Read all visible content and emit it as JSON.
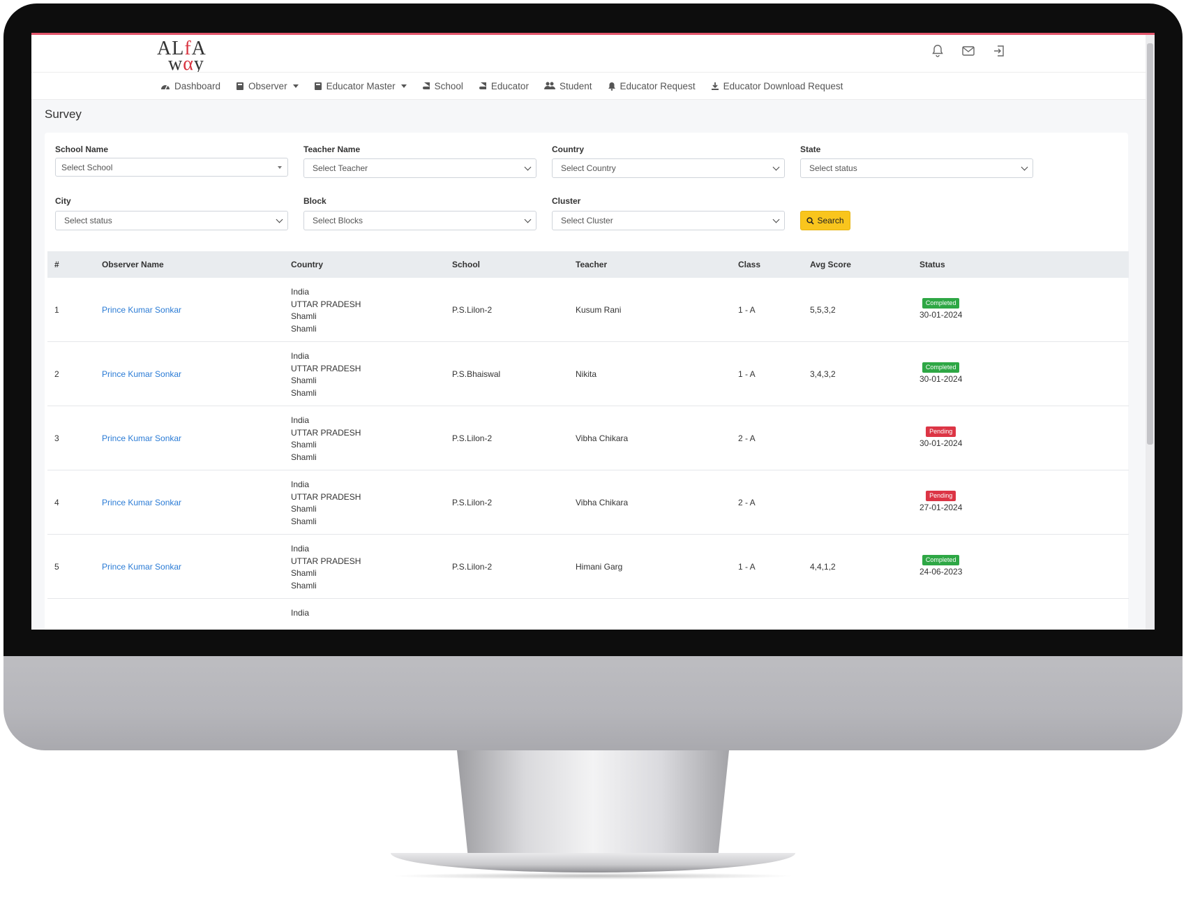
{
  "app": {
    "logo_top": "ALfA",
    "logo_bottom": "wαy"
  },
  "nav": {
    "items": [
      {
        "label": "Dashboard",
        "icon": "dashboard-icon",
        "dropdown": false
      },
      {
        "label": "Observer",
        "icon": "book-icon",
        "dropdown": true
      },
      {
        "label": "Educator Master",
        "icon": "book-icon",
        "dropdown": true
      },
      {
        "label": "School",
        "icon": "book-icon",
        "dropdown": false
      },
      {
        "label": "Educator",
        "icon": "book-icon",
        "dropdown": false
      },
      {
        "label": "Student",
        "icon": "users-icon",
        "dropdown": false
      },
      {
        "label": "Educator Request",
        "icon": "bell-icon",
        "dropdown": false
      },
      {
        "label": "Educator Download Request",
        "icon": "download-icon",
        "dropdown": false
      }
    ],
    "top_icons": [
      "bell-icon",
      "mail-icon",
      "logout-icon"
    ]
  },
  "page": {
    "title": "Survey"
  },
  "filters": {
    "school": {
      "label": "School Name",
      "value": "Select School"
    },
    "teacher": {
      "label": "Teacher Name",
      "value": "Select Teacher"
    },
    "country": {
      "label": "Country",
      "value": "Select Country"
    },
    "state": {
      "label": "State",
      "value": "Select status"
    },
    "city": {
      "label": "City",
      "value": "Select status"
    },
    "block": {
      "label": "Block",
      "value": "Select Blocks"
    },
    "cluster": {
      "label": "Cluster",
      "value": "Select Cluster"
    },
    "search_label": "Search"
  },
  "table": {
    "headers": [
      "#",
      "Observer Name",
      "Country",
      "School",
      "Teacher",
      "Class",
      "Avg Score",
      "Status"
    ],
    "rows": [
      {
        "num": "1",
        "observer": "Prince Kumar Sonkar",
        "country": "India",
        "state": "UTTAR PRADESH",
        "district": "Shamli",
        "city": "Shamli",
        "school": "P.S.Lilon-2",
        "teacher": "Kusum Rani",
        "class": "1 - A",
        "score": "5,5,3,2",
        "status": "Completed",
        "date": "30-01-2024"
      },
      {
        "num": "2",
        "observer": "Prince Kumar Sonkar",
        "country": "India",
        "state": "UTTAR PRADESH",
        "district": "Shamli",
        "city": "Shamli",
        "school": "P.S.Bhaiswal",
        "teacher": "Nikita",
        "class": "1 - A",
        "score": "3,4,3,2",
        "status": "Completed",
        "date": "30-01-2024"
      },
      {
        "num": "3",
        "observer": "Prince Kumar Sonkar",
        "country": "India",
        "state": "UTTAR PRADESH",
        "district": "Shamli",
        "city": "Shamli",
        "school": "P.S.Lilon-2",
        "teacher": "Vibha Chikara",
        "class": "2 - A",
        "score": "",
        "status": "Pending",
        "date": "30-01-2024"
      },
      {
        "num": "4",
        "observer": "Prince Kumar Sonkar",
        "country": "India",
        "state": "UTTAR PRADESH",
        "district": "Shamli",
        "city": "Shamli",
        "school": "P.S.Lilon-2",
        "teacher": "Vibha Chikara",
        "class": "2 - A",
        "score": "",
        "status": "Pending",
        "date": "27-01-2024"
      },
      {
        "num": "5",
        "observer": "Prince Kumar Sonkar",
        "country": "India",
        "state": "UTTAR PRADESH",
        "district": "Shamli",
        "city": "Shamli",
        "school": "P.S.Lilon-2",
        "teacher": "Himani Garg",
        "class": "1 - A",
        "score": "4,4,1,2",
        "status": "Completed",
        "date": "24-06-2023"
      }
    ],
    "partial_row_country": "India"
  },
  "colors": {
    "accent_line": "#e2556b",
    "link": "#2a7bd5",
    "completed": "#2ea745",
    "pending": "#dc3545",
    "search_button": "#f9c51d"
  }
}
